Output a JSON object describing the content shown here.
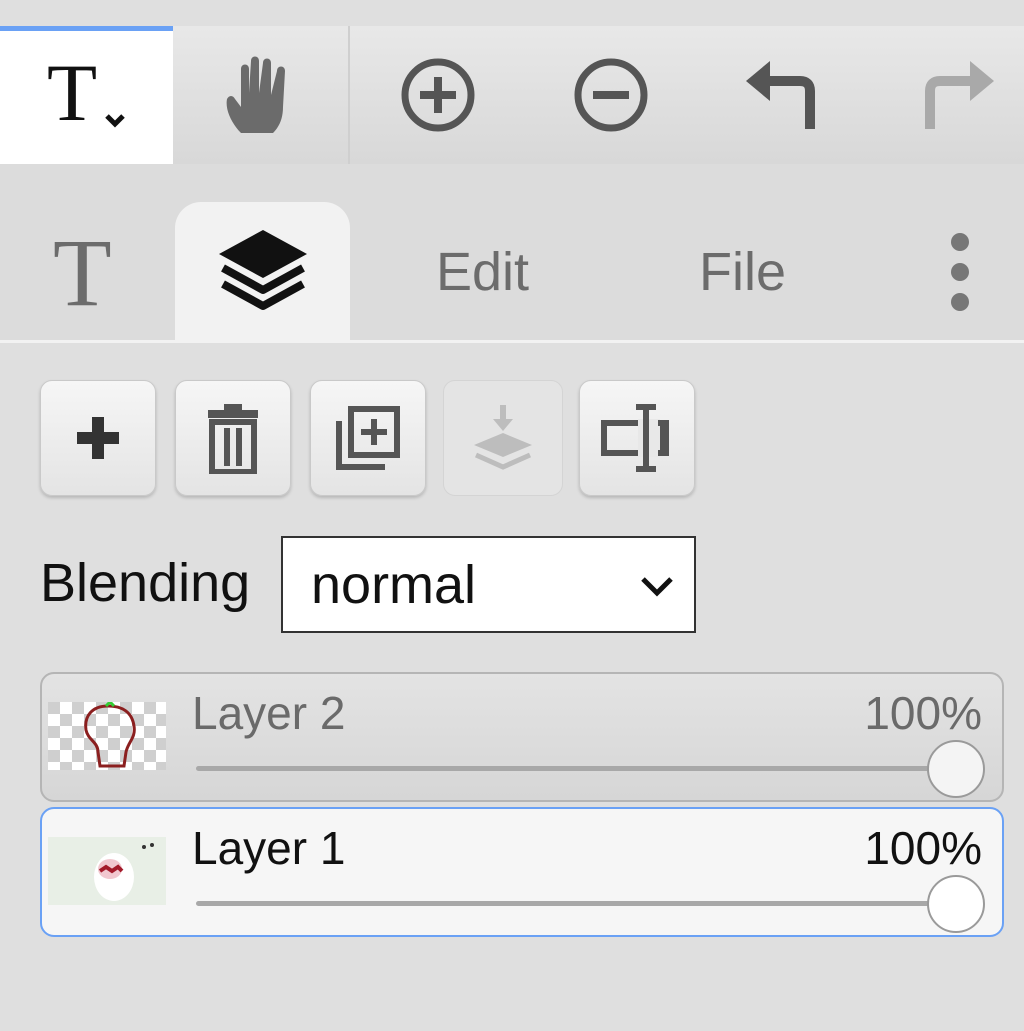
{
  "toolbar": {
    "tools": [
      {
        "name": "text-tool",
        "icon": "text-t-icon",
        "active": true
      },
      {
        "name": "hand-tool",
        "icon": "hand-icon"
      },
      {
        "name": "zoom-in",
        "icon": "zoom-in-icon"
      },
      {
        "name": "zoom-out",
        "icon": "zoom-out-icon"
      },
      {
        "name": "undo",
        "icon": "undo-icon"
      },
      {
        "name": "redo",
        "icon": "redo-icon",
        "disabled": true
      }
    ]
  },
  "tabs": {
    "text_tab_icon": "text-t-icon",
    "layers_tab_icon": "layers-icon",
    "edit_label": "Edit",
    "file_label": "File",
    "more_icon": "more-vertical-icon"
  },
  "layer_actions": [
    {
      "icon": "plus-icon"
    },
    {
      "icon": "trash-icon"
    },
    {
      "icon": "duplicate-icon"
    },
    {
      "icon": "merge-down-icon",
      "disabled": true
    },
    {
      "icon": "rename-icon"
    }
  ],
  "blending": {
    "label": "Blending",
    "value": "normal"
  },
  "layers": [
    {
      "name": "Layer 2",
      "opacity": "100%",
      "opacity_value": 1.0,
      "selected": false
    },
    {
      "name": "Layer 1",
      "opacity": "100%",
      "opacity_value": 1.0,
      "selected": true
    }
  ],
  "colors": {
    "accent": "#6aa1f5",
    "background": "#dfdfdf"
  }
}
